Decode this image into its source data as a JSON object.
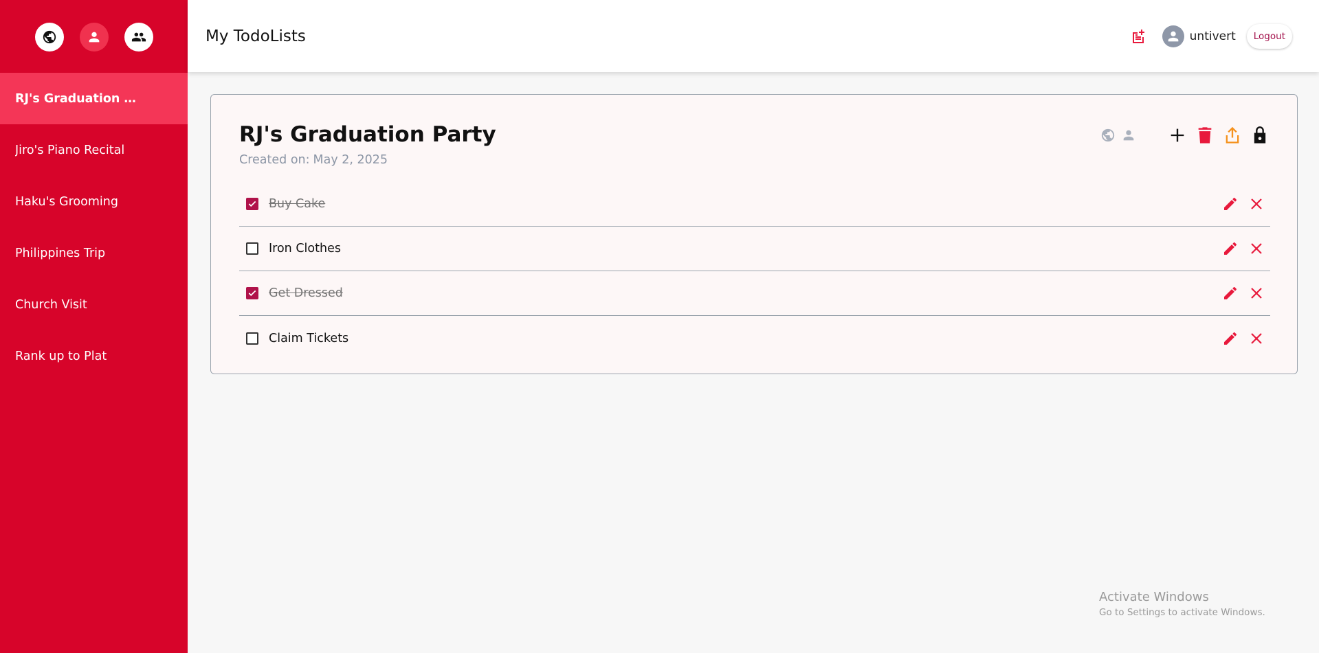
{
  "sidebar": {
    "top_icons": [
      {
        "name": "globe-icon",
        "label": "public"
      },
      {
        "name": "person-icon",
        "label": "personal"
      },
      {
        "name": "group-icon",
        "label": "shared"
      }
    ],
    "items": [
      {
        "label": "RJ's Graduation Pa..."
      },
      {
        "label": "Jiro's Piano Recital"
      },
      {
        "label": "Haku's Grooming"
      },
      {
        "label": "Philippines Trip"
      },
      {
        "label": "Church Visit"
      },
      {
        "label": "Rank up to Plat"
      }
    ]
  },
  "header": {
    "title": "My TodoLists",
    "username": "untivert",
    "logout_label": "Logout"
  },
  "list": {
    "title": "RJ's Graduation Party",
    "created_prefix": "Created on:",
    "created_date": "May 2, 2025",
    "items": [
      {
        "text": "Buy Cake",
        "done": true
      },
      {
        "text": "Iron Clothes",
        "done": false
      },
      {
        "text": "Get Dressed",
        "done": true
      },
      {
        "text": "Claim Tickets",
        "done": false
      }
    ]
  },
  "watermark": {
    "title": "Activate Windows",
    "subtitle": "Go to Settings to activate Windows."
  },
  "colors": {
    "sidebar_bg": "#d7042a",
    "sidebar_active": "#f43657",
    "checkbox_checked": "#b0124a",
    "icon_red": "#e8193c",
    "share_orange": "#f5921e"
  }
}
